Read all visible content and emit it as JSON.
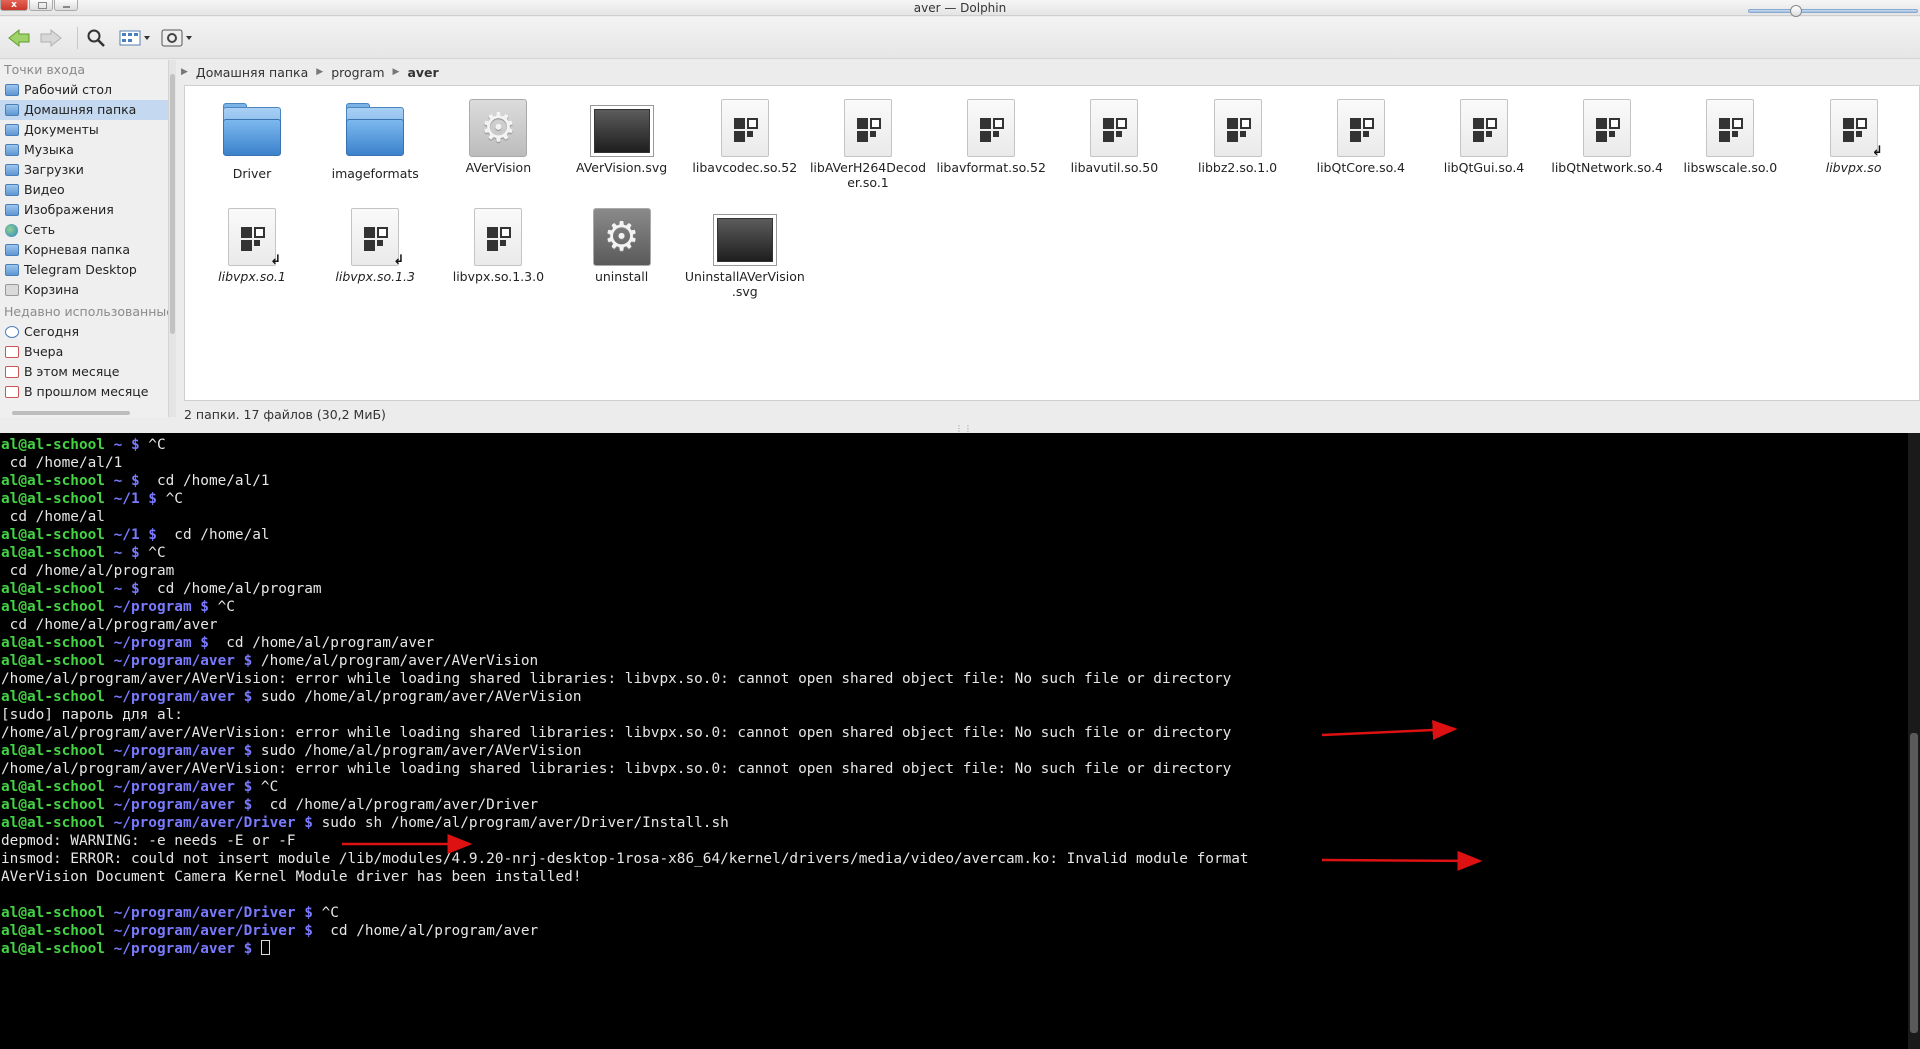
{
  "window": {
    "title": "aver — Dolphin",
    "close_label": "x"
  },
  "sidebar": {
    "places_header": "Точки входа",
    "places": [
      {
        "label": "Рабочий стол",
        "icon": "folder-icon"
      },
      {
        "label": "Домашняя папка",
        "icon": "folder-icon",
        "selected": true
      },
      {
        "label": "Документы",
        "icon": "folder-icon"
      },
      {
        "label": "Музыка",
        "icon": "folder-icon"
      },
      {
        "label": "Загрузки",
        "icon": "folder-icon"
      },
      {
        "label": "Видео",
        "icon": "folder-icon"
      },
      {
        "label": "Изображения",
        "icon": "folder-icon"
      },
      {
        "label": "Сеть",
        "icon": "network-icon"
      },
      {
        "label": "Корневая папка",
        "icon": "folder-icon"
      },
      {
        "label": "Telegram Desktop",
        "icon": "folder-icon"
      },
      {
        "label": "Корзина",
        "icon": "trash-icon"
      }
    ],
    "recent_header": "Недавно использованные",
    "recent": [
      {
        "label": "Сегодня",
        "icon": "today-icon"
      },
      {
        "label": "Вчера",
        "icon": "calendar-icon"
      },
      {
        "label": "В этом месяце",
        "icon": "calendar-icon"
      },
      {
        "label": "В прошлом месяце",
        "icon": "calendar-icon"
      }
    ]
  },
  "breadcrumb": [
    "Домашняя папка",
    "program",
    "aver"
  ],
  "files": [
    {
      "name": "Driver",
      "type": "folder"
    },
    {
      "name": "imageformats",
      "type": "folder"
    },
    {
      "name": "AVerVision",
      "type": "exec"
    },
    {
      "name": "AVerVision.svg",
      "type": "svg"
    },
    {
      "name": "libavcodec.so.52",
      "type": "lib"
    },
    {
      "name": "libAVerH264Decoder.so.1",
      "type": "lib"
    },
    {
      "name": "libavformat.so.52",
      "type": "lib"
    },
    {
      "name": "libavutil.so.50",
      "type": "lib"
    },
    {
      "name": "libbz2.so.1.0",
      "type": "lib"
    },
    {
      "name": "libQtCore.so.4",
      "type": "lib"
    },
    {
      "name": "libQtGui.so.4",
      "type": "lib"
    },
    {
      "name": "libQtNetwork.so.4",
      "type": "lib"
    },
    {
      "name": "libswscale.so.0",
      "type": "lib"
    },
    {
      "name": "libvpx.so",
      "type": "lib",
      "link": true
    },
    {
      "name": "libvpx.so.1",
      "type": "lib",
      "link": true
    },
    {
      "name": "libvpx.so.1.3",
      "type": "lib",
      "link": true
    },
    {
      "name": "libvpx.so.1.3.0",
      "type": "lib"
    },
    {
      "name": "uninstall",
      "type": "exec-dark"
    },
    {
      "name": "UninstallAVerVision.svg",
      "type": "svg"
    }
  ],
  "status": {
    "text": "2 папки. 17 файлов (30,2 МиБ)",
    "zoom_level": 0.25
  },
  "terminal": {
    "lines": [
      [
        [
          "u",
          "al@al-school"
        ],
        [
          "p",
          " ~ $ "
        ],
        [
          "t",
          "^C"
        ]
      ],
      [
        [
          "t",
          " cd /home/al/1"
        ]
      ],
      [
        [
          "u",
          "al@al-school"
        ],
        [
          "p",
          " ~ $ "
        ],
        [
          "t",
          " cd /home/al/1"
        ]
      ],
      [
        [
          "u",
          "al@al-school"
        ],
        [
          "p",
          " ~/1 $ "
        ],
        [
          "t",
          "^C"
        ]
      ],
      [
        [
          "t",
          " cd /home/al"
        ]
      ],
      [
        [
          "u",
          "al@al-school"
        ],
        [
          "p",
          " ~/1 $ "
        ],
        [
          "t",
          " cd /home/al"
        ]
      ],
      [
        [
          "u",
          "al@al-school"
        ],
        [
          "p",
          " ~ $ "
        ],
        [
          "t",
          "^C"
        ]
      ],
      [
        [
          "t",
          " cd /home/al/program"
        ]
      ],
      [
        [
          "u",
          "al@al-school"
        ],
        [
          "p",
          " ~ $ "
        ],
        [
          "t",
          " cd /home/al/program"
        ]
      ],
      [
        [
          "u",
          "al@al-school"
        ],
        [
          "p",
          " ~/program $ "
        ],
        [
          "t",
          "^C"
        ]
      ],
      [
        [
          "t",
          " cd /home/al/program/aver"
        ]
      ],
      [
        [
          "u",
          "al@al-school"
        ],
        [
          "p",
          " ~/program $ "
        ],
        [
          "t",
          " cd /home/al/program/aver"
        ]
      ],
      [
        [
          "u",
          "al@al-school"
        ],
        [
          "p",
          " ~/program/aver $ "
        ],
        [
          "t",
          "/home/al/program/aver/AVerVision"
        ]
      ],
      [
        [
          "t",
          "/home/al/program/aver/AVerVision: error while loading shared libraries: libvpx.so.0: cannot open shared object file: No such file or directory"
        ]
      ],
      [
        [
          "u",
          "al@al-school"
        ],
        [
          "p",
          " ~/program/aver $ "
        ],
        [
          "t",
          "sudo /home/al/program/aver/AVerVision"
        ]
      ],
      [
        [
          "t",
          "[sudo] пароль для al:"
        ]
      ],
      [
        [
          "t",
          "/home/al/program/aver/AVerVision: error while loading shared libraries: libvpx.so.0: cannot open shared object file: No such file or directory"
        ]
      ],
      [
        [
          "u",
          "al@al-school"
        ],
        [
          "p",
          " ~/program/aver $ "
        ],
        [
          "t",
          "sudo /home/al/program/aver/AVerVision"
        ]
      ],
      [
        [
          "t",
          "/home/al/program/aver/AVerVision: error while loading shared libraries: libvpx.so.0: cannot open shared object file: No such file or directory"
        ]
      ],
      [
        [
          "u",
          "al@al-school"
        ],
        [
          "p",
          " ~/program/aver $ "
        ],
        [
          "t",
          "^C"
        ]
      ],
      [
        [
          "u",
          "al@al-school"
        ],
        [
          "p",
          " ~/program/aver $ "
        ],
        [
          "t",
          " cd /home/al/program/aver/Driver"
        ]
      ],
      [
        [
          "u",
          "al@al-school"
        ],
        [
          "p",
          " ~/program/aver/Driver $ "
        ],
        [
          "t",
          "sudo sh /home/al/program/aver/Driver/Install.sh"
        ]
      ],
      [
        [
          "t",
          "depmod: WARNING: -e needs -E or -F"
        ]
      ],
      [
        [
          "t",
          "insmod: ERROR: could not insert module /lib/modules/4.9.20-nrj-desktop-1rosa-x86_64/kernel/drivers/media/video/avercam.ko: Invalid module format"
        ]
      ],
      [
        [
          "t",
          "AVerVision Document Camera Kernel Module driver has been installed!"
        ]
      ],
      [
        [
          "t",
          ""
        ]
      ],
      [
        [
          "u",
          "al@al-school"
        ],
        [
          "p",
          " ~/program/aver/Driver $ "
        ],
        [
          "t",
          "^C"
        ]
      ],
      [
        [
          "u",
          "al@al-school"
        ],
        [
          "p",
          " ~/program/aver/Driver $ "
        ],
        [
          "t",
          " cd /home/al/program/aver"
        ]
      ],
      [
        [
          "u",
          "al@al-school"
        ],
        [
          "p",
          " ~/program/aver $ "
        ],
        [
          "cursor",
          ""
        ]
      ]
    ]
  },
  "colors": {
    "annotation_arrow": "#dd1111",
    "prompt_user": "#43d343",
    "prompt_path": "#7a7aff",
    "selection": "#c4d8ef"
  }
}
